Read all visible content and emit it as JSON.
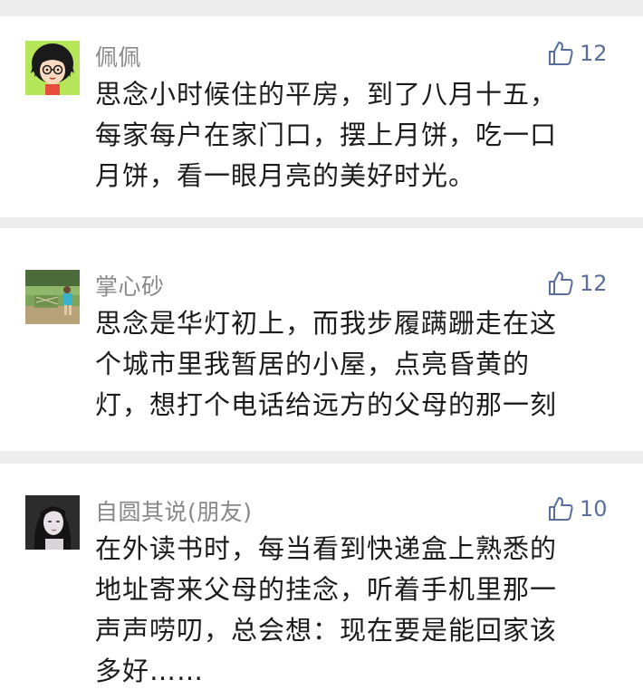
{
  "comments": [
    {
      "nickname": "佩佩",
      "likes": "12",
      "avatar": "cartoon-girl-avatar",
      "lines": [
        "思念小时候住的平房，到了八月十五，",
        "每家每户在家门口，摆上月饼，吃一口",
        "月饼，看一眼月亮的美好时光。"
      ]
    },
    {
      "nickname": "掌心砂",
      "likes": "12",
      "avatar": "child-photo-avatar",
      "lines": [
        "思念是华灯初上，而我步履蹒跚走在这",
        "个城市里我暂居的小屋，点亮昏黄的",
        "灯，想打个电话给远方的父母的那一刻"
      ]
    },
    {
      "nickname": "自圆其说(朋友)",
      "likes": "10",
      "avatar": "woman-portrait-avatar",
      "lines": [
        "在外读书时，每当看到快递盒上熟悉的",
        "地址寄来父母的挂念，听着手机里那一",
        "声声唠叨，总会想：现在要是能回家该",
        "多好……"
      ]
    }
  ],
  "colors": {
    "like": "#5a6e9c",
    "nickname": "#888888",
    "text": "#1b1b1b",
    "background": "#ededed"
  }
}
